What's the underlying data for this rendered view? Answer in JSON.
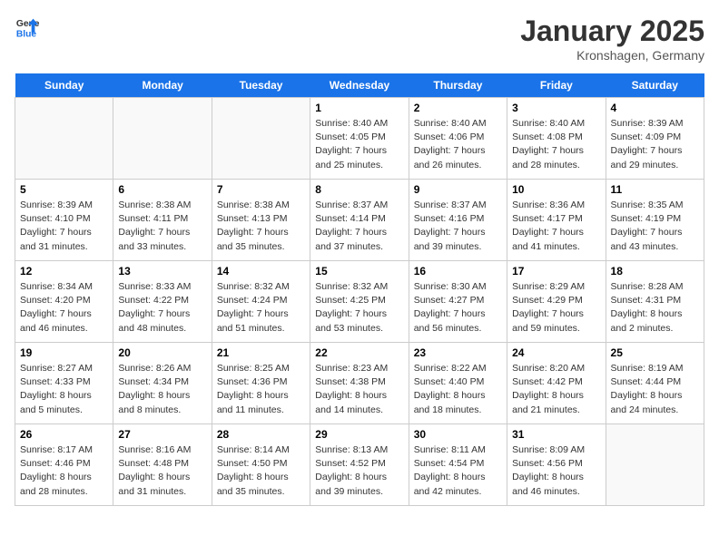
{
  "header": {
    "logo_general": "General",
    "logo_blue": "Blue",
    "title": "January 2025",
    "subtitle": "Kronshagen, Germany"
  },
  "weekdays": [
    "Sunday",
    "Monday",
    "Tuesday",
    "Wednesday",
    "Thursday",
    "Friday",
    "Saturday"
  ],
  "weeks": [
    [
      {
        "day": "",
        "info": ""
      },
      {
        "day": "",
        "info": ""
      },
      {
        "day": "",
        "info": ""
      },
      {
        "day": "1",
        "info": "Sunrise: 8:40 AM\nSunset: 4:05 PM\nDaylight: 7 hours\nand 25 minutes."
      },
      {
        "day": "2",
        "info": "Sunrise: 8:40 AM\nSunset: 4:06 PM\nDaylight: 7 hours\nand 26 minutes."
      },
      {
        "day": "3",
        "info": "Sunrise: 8:40 AM\nSunset: 4:08 PM\nDaylight: 7 hours\nand 28 minutes."
      },
      {
        "day": "4",
        "info": "Sunrise: 8:39 AM\nSunset: 4:09 PM\nDaylight: 7 hours\nand 29 minutes."
      }
    ],
    [
      {
        "day": "5",
        "info": "Sunrise: 8:39 AM\nSunset: 4:10 PM\nDaylight: 7 hours\nand 31 minutes."
      },
      {
        "day": "6",
        "info": "Sunrise: 8:38 AM\nSunset: 4:11 PM\nDaylight: 7 hours\nand 33 minutes."
      },
      {
        "day": "7",
        "info": "Sunrise: 8:38 AM\nSunset: 4:13 PM\nDaylight: 7 hours\nand 35 minutes."
      },
      {
        "day": "8",
        "info": "Sunrise: 8:37 AM\nSunset: 4:14 PM\nDaylight: 7 hours\nand 37 minutes."
      },
      {
        "day": "9",
        "info": "Sunrise: 8:37 AM\nSunset: 4:16 PM\nDaylight: 7 hours\nand 39 minutes."
      },
      {
        "day": "10",
        "info": "Sunrise: 8:36 AM\nSunset: 4:17 PM\nDaylight: 7 hours\nand 41 minutes."
      },
      {
        "day": "11",
        "info": "Sunrise: 8:35 AM\nSunset: 4:19 PM\nDaylight: 7 hours\nand 43 minutes."
      }
    ],
    [
      {
        "day": "12",
        "info": "Sunrise: 8:34 AM\nSunset: 4:20 PM\nDaylight: 7 hours\nand 46 minutes."
      },
      {
        "day": "13",
        "info": "Sunrise: 8:33 AM\nSunset: 4:22 PM\nDaylight: 7 hours\nand 48 minutes."
      },
      {
        "day": "14",
        "info": "Sunrise: 8:32 AM\nSunset: 4:24 PM\nDaylight: 7 hours\nand 51 minutes."
      },
      {
        "day": "15",
        "info": "Sunrise: 8:32 AM\nSunset: 4:25 PM\nDaylight: 7 hours\nand 53 minutes."
      },
      {
        "day": "16",
        "info": "Sunrise: 8:30 AM\nSunset: 4:27 PM\nDaylight: 7 hours\nand 56 minutes."
      },
      {
        "day": "17",
        "info": "Sunrise: 8:29 AM\nSunset: 4:29 PM\nDaylight: 7 hours\nand 59 minutes."
      },
      {
        "day": "18",
        "info": "Sunrise: 8:28 AM\nSunset: 4:31 PM\nDaylight: 8 hours\nand 2 minutes."
      }
    ],
    [
      {
        "day": "19",
        "info": "Sunrise: 8:27 AM\nSunset: 4:33 PM\nDaylight: 8 hours\nand 5 minutes."
      },
      {
        "day": "20",
        "info": "Sunrise: 8:26 AM\nSunset: 4:34 PM\nDaylight: 8 hours\nand 8 minutes."
      },
      {
        "day": "21",
        "info": "Sunrise: 8:25 AM\nSunset: 4:36 PM\nDaylight: 8 hours\nand 11 minutes."
      },
      {
        "day": "22",
        "info": "Sunrise: 8:23 AM\nSunset: 4:38 PM\nDaylight: 8 hours\nand 14 minutes."
      },
      {
        "day": "23",
        "info": "Sunrise: 8:22 AM\nSunset: 4:40 PM\nDaylight: 8 hours\nand 18 minutes."
      },
      {
        "day": "24",
        "info": "Sunrise: 8:20 AM\nSunset: 4:42 PM\nDaylight: 8 hours\nand 21 minutes."
      },
      {
        "day": "25",
        "info": "Sunrise: 8:19 AM\nSunset: 4:44 PM\nDaylight: 8 hours\nand 24 minutes."
      }
    ],
    [
      {
        "day": "26",
        "info": "Sunrise: 8:17 AM\nSunset: 4:46 PM\nDaylight: 8 hours\nand 28 minutes."
      },
      {
        "day": "27",
        "info": "Sunrise: 8:16 AM\nSunset: 4:48 PM\nDaylight: 8 hours\nand 31 minutes."
      },
      {
        "day": "28",
        "info": "Sunrise: 8:14 AM\nSunset: 4:50 PM\nDaylight: 8 hours\nand 35 minutes."
      },
      {
        "day": "29",
        "info": "Sunrise: 8:13 AM\nSunset: 4:52 PM\nDaylight: 8 hours\nand 39 minutes."
      },
      {
        "day": "30",
        "info": "Sunrise: 8:11 AM\nSunset: 4:54 PM\nDaylight: 8 hours\nand 42 minutes."
      },
      {
        "day": "31",
        "info": "Sunrise: 8:09 AM\nSunset: 4:56 PM\nDaylight: 8 hours\nand 46 minutes."
      },
      {
        "day": "",
        "info": ""
      }
    ]
  ]
}
